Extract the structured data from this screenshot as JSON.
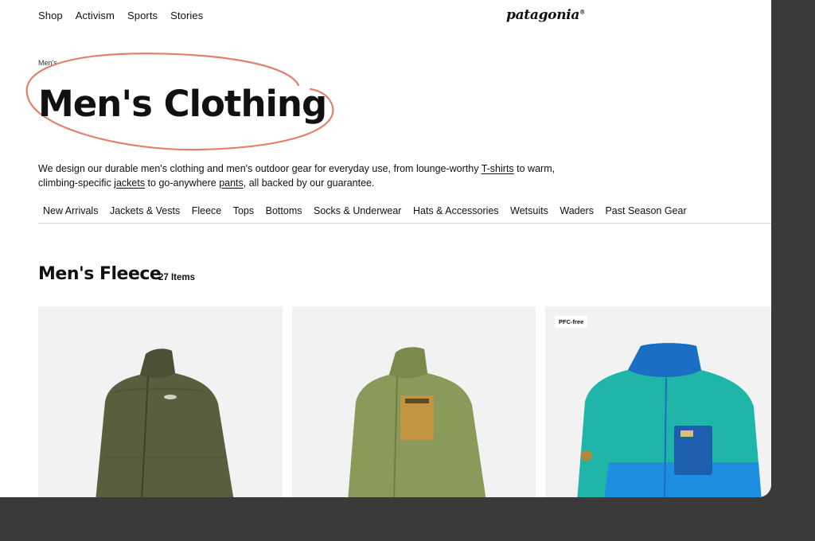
{
  "topnav": {
    "items": [
      "Shop",
      "Activism",
      "Sports",
      "Stories"
    ]
  },
  "brand": {
    "logo_text": "patagonia"
  },
  "breadcrumb": {
    "label": "Men's"
  },
  "page": {
    "title": "Men's Clothing",
    "intro": {
      "part1": "We design our durable men's clothing and men's outdoor gear for everyday use, from lounge-worthy ",
      "link1": "T-shirts",
      "part2": " to warm, climbing-specific ",
      "link2": "jackets",
      "part3": " to go-anywhere ",
      "link3": "pants",
      "part4": ", all backed by our guarantee."
    }
  },
  "categories": [
    "New Arrivals",
    "Jackets & Vests",
    "Fleece",
    "Tops",
    "Bottoms",
    "Socks & Underwear",
    "Hats & Accessories",
    "Wetsuits",
    "Waders",
    "Past Season Gear"
  ],
  "section": {
    "title": "Men's Fleece",
    "count": "27 Items"
  },
  "products": [
    {
      "color": "#5a5e3f",
      "badge": ""
    },
    {
      "color": "#8a9a5a",
      "badge": ""
    },
    {
      "color": "#1fb5a8",
      "badge": "PFC-free"
    }
  ],
  "colors": {
    "annotation_circle": "#e0816d",
    "card_bg": "#f2f2f2",
    "outer_bg": "#3a3a3a"
  }
}
